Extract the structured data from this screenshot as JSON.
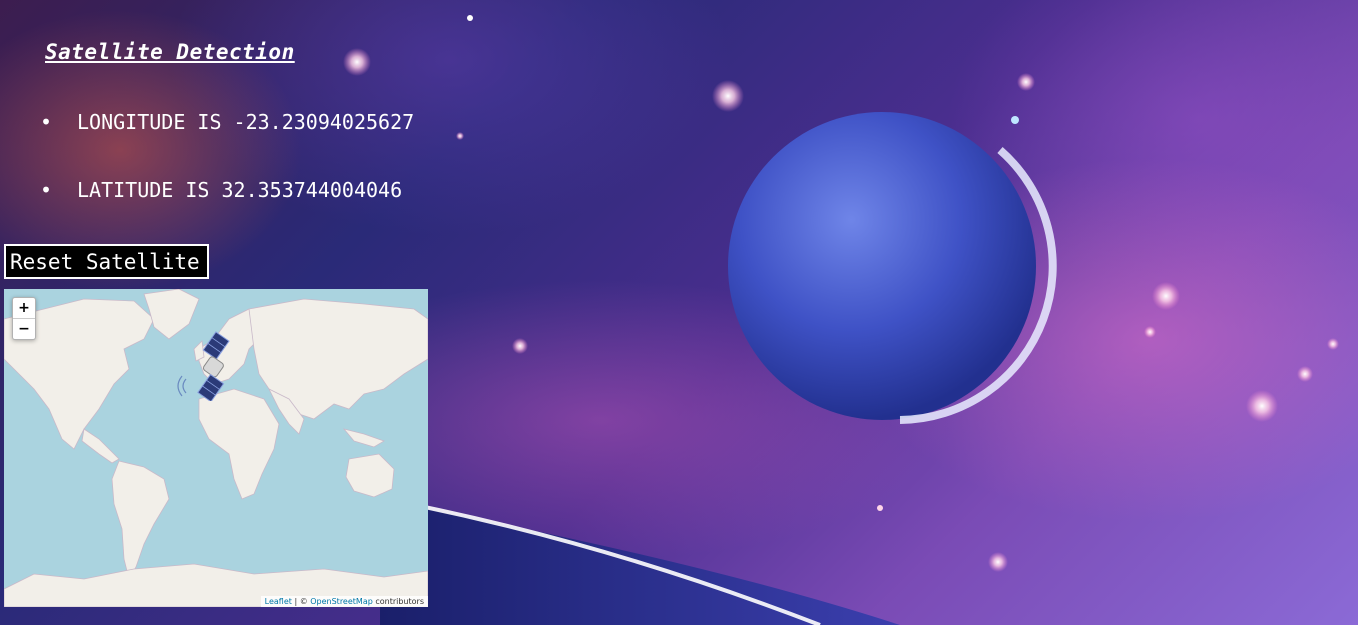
{
  "page": {
    "title": "Satellite Detection",
    "longitude_label": "LONGITUDE IS -23.23094025627",
    "latitude_label": "LATITUDE IS 32.353744004046",
    "reset_button_label": "Reset Satellite"
  },
  "map": {
    "zoom_in_label": "+",
    "zoom_out_label": "−",
    "attribution": {
      "leaflet_link": "Leaflet",
      "separator": " | © ",
      "osm_link": "OpenStreetMap",
      "suffix": " contributors"
    },
    "marker_icon": "satellite-icon",
    "colors": {
      "water": "#aad3df",
      "land": "#f2efe9",
      "border": "#c9b9c9"
    }
  },
  "background": {
    "image": "space-nebula-planet",
    "accent_colors": [
      "#2a2a78",
      "#7a4bb5",
      "#d46bb8",
      "#ffffff"
    ]
  }
}
